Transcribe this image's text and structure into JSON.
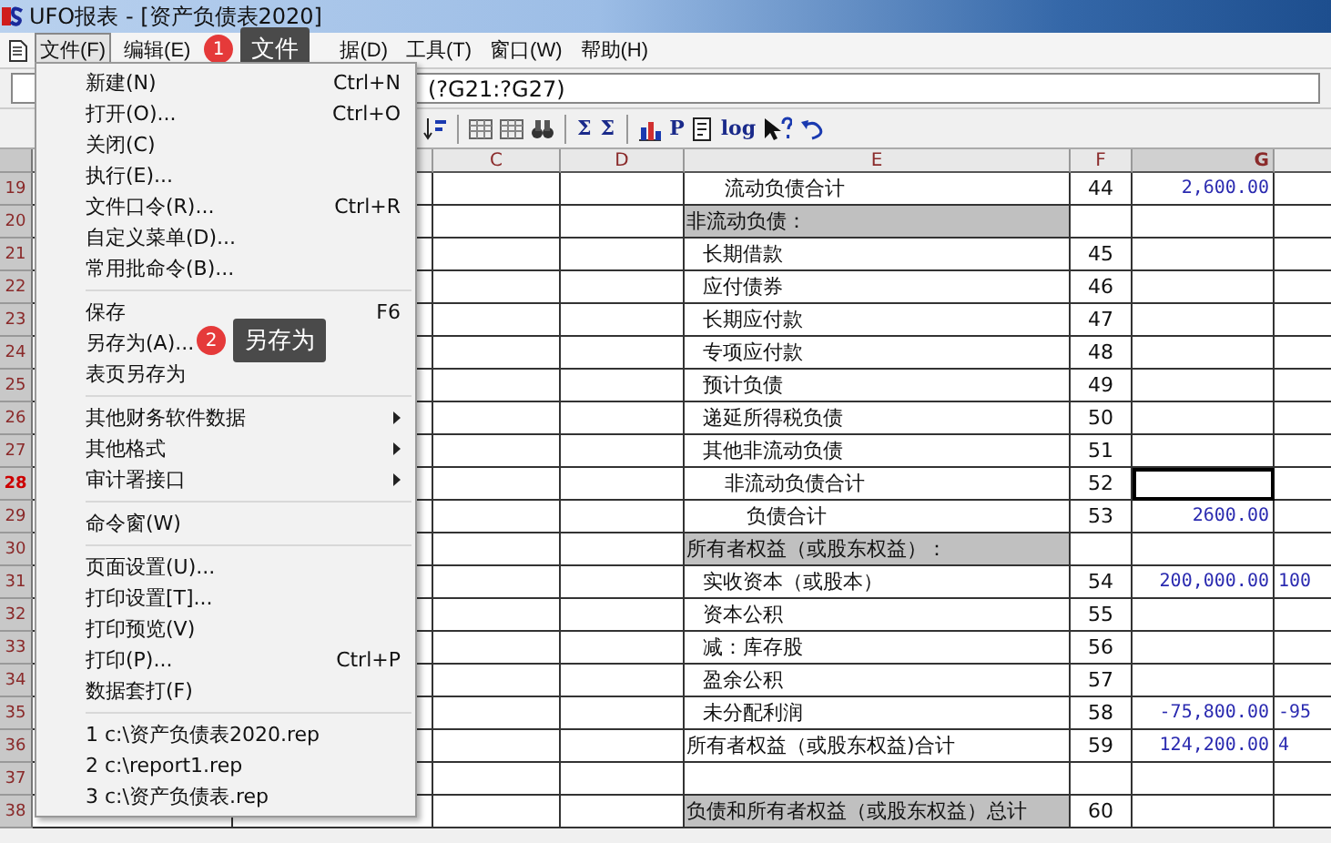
{
  "window": {
    "title": "UFO报表 - [资产负债表2020]"
  },
  "menubar": {
    "items": [
      {
        "label": "文件(F)",
        "selected": true
      },
      {
        "label": "编辑(E)",
        "selected": false
      },
      {
        "label": "据(D)",
        "selected": false
      },
      {
        "label": "工具(T)",
        "selected": false
      },
      {
        "label": "窗口(W)",
        "selected": false
      },
      {
        "label": "帮助(H)",
        "selected": false
      }
    ],
    "callout": {
      "number": "1",
      "text": "文件"
    }
  },
  "formula_bar": {
    "formula": "(?G21:?G27)"
  },
  "toolbar": [
    {
      "kind": "sort"
    },
    {
      "kind": "sep"
    },
    {
      "kind": "grid"
    },
    {
      "kind": "grid"
    },
    {
      "kind": "find"
    },
    {
      "kind": "sep"
    },
    {
      "kind": "glyph",
      "text": "Σ"
    },
    {
      "kind": "glyph",
      "text": "Σ"
    },
    {
      "kind": "sep"
    },
    {
      "kind": "chart"
    },
    {
      "kind": "glyph",
      "text": "P"
    },
    {
      "kind": "page"
    },
    {
      "kind": "glyph",
      "text": "log"
    },
    {
      "kind": "help"
    },
    {
      "kind": "undo"
    }
  ],
  "columns": [
    {
      "label": "C",
      "selected": false
    },
    {
      "label": "D",
      "selected": false
    },
    {
      "label": "E",
      "selected": false
    },
    {
      "label": "F",
      "selected": false
    },
    {
      "label": "G",
      "selected": true
    }
  ],
  "rows": [
    {
      "number": "19",
      "selected": false,
      "kind": "subtotal",
      "item": "流动负债合计",
      "line": "44",
      "value": "2,600.00"
    },
    {
      "number": "20",
      "selected": false,
      "kind": "heading",
      "item": "非流动负债："
    },
    {
      "number": "21",
      "selected": false,
      "kind": "item",
      "item": "长期借款",
      "line": "45"
    },
    {
      "number": "22",
      "selected": false,
      "kind": "item",
      "item": "应付债券",
      "line": "46"
    },
    {
      "number": "23",
      "selected": false,
      "kind": "item",
      "item": "长期应付款",
      "line": "47"
    },
    {
      "number": "24",
      "selected": false,
      "kind": "item",
      "item": "专项应付款",
      "line": "48"
    },
    {
      "number": "25",
      "selected": false,
      "kind": "item",
      "item": "预计负债",
      "line": "49"
    },
    {
      "number": "26",
      "selected": false,
      "kind": "item",
      "item": "递延所得税负债",
      "line": "50"
    },
    {
      "number": "27",
      "selected": false,
      "kind": "item",
      "item": "其他非流动负债",
      "line": "51"
    },
    {
      "number": "28",
      "selected": true,
      "kind": "subtotal",
      "item": "非流动负债合计",
      "line": "52"
    },
    {
      "number": "29",
      "selected": false,
      "kind": "total",
      "item": "负债合计",
      "line": "53",
      "value": "2600.00"
    },
    {
      "number": "30",
      "selected": false,
      "kind": "heading",
      "item": "所有者权益（或股东权益）："
    },
    {
      "number": "31",
      "selected": false,
      "kind": "item",
      "item": "实收资本（或股本）",
      "line": "54",
      "value": "200,000.00",
      "column_h": "100"
    },
    {
      "number": "32",
      "selected": false,
      "kind": "item",
      "item": "资本公积",
      "line": "55"
    },
    {
      "number": "33",
      "selected": false,
      "kind": "item",
      "item": "减：库存股",
      "line": "56"
    },
    {
      "number": "34",
      "selected": false,
      "kind": "item",
      "item": "盈余公积",
      "line": "57"
    },
    {
      "number": "35",
      "selected": false,
      "kind": "item",
      "item": "未分配利润",
      "line": "58",
      "value": "-75,800.00",
      "column_h": "-95"
    },
    {
      "number": "36",
      "selected": false,
      "kind": "plain",
      "item": "所有者权益（或股东权益)合计",
      "line": "59",
      "value": "124,200.00",
      "column_h": "4"
    },
    {
      "number": "37",
      "selected": false,
      "kind": "plain"
    },
    {
      "number": "38",
      "selected": false,
      "kind": "heading",
      "item": "负债和所有者权益（或股东权益）总计",
      "line": "60"
    }
  ],
  "file_menu": [
    {
      "kind": "item",
      "label": "新建(N)",
      "shortcut": "Ctrl+N"
    },
    {
      "kind": "item",
      "label": "打开(O)...",
      "shortcut": "Ctrl+O"
    },
    {
      "kind": "item",
      "label": "关闭(C)"
    },
    {
      "kind": "item",
      "label": "执行(E)..."
    },
    {
      "kind": "item",
      "label": "文件口令(R)...",
      "shortcut": "Ctrl+R"
    },
    {
      "kind": "item",
      "label": "自定义菜单(D)..."
    },
    {
      "kind": "item",
      "label": "常用批命令(B)..."
    },
    {
      "kind": "separator"
    },
    {
      "kind": "item",
      "label": "保存",
      "shortcut": "F6"
    },
    {
      "kind": "item",
      "label": "另存为(A)...",
      "callout": {
        "number": "2",
        "text": "另存为"
      }
    },
    {
      "kind": "item",
      "label": "表页另存为"
    },
    {
      "kind": "separator"
    },
    {
      "kind": "submenu",
      "label": "其他财务软件数据"
    },
    {
      "kind": "submenu",
      "label": "其他格式"
    },
    {
      "kind": "submenu",
      "label": "审计署接口"
    },
    {
      "kind": "separator"
    },
    {
      "kind": "item",
      "label": "命令窗(W)"
    },
    {
      "kind": "separator"
    },
    {
      "kind": "item",
      "label": "页面设置(U)..."
    },
    {
      "kind": "item",
      "label": "打印设置[T]..."
    },
    {
      "kind": "item",
      "label": "打印预览(V)"
    },
    {
      "kind": "item",
      "label": "打印(P)...",
      "shortcut": "Ctrl+P"
    },
    {
      "kind": "item",
      "label": "数据套打(F)"
    },
    {
      "kind": "separator"
    },
    {
      "kind": "item",
      "label": "1 c:\\资产负债表2020.rep"
    },
    {
      "kind": "item",
      "label": "2 c:\\report1.rep"
    },
    {
      "kind": "item",
      "label": "3 c:\\资产负债表.rep"
    }
  ]
}
